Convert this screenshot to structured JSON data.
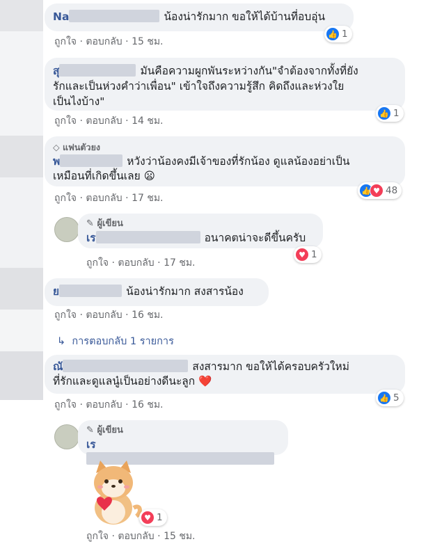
{
  "comments": [
    {
      "name": "Na",
      "text": "น้องน่ารักมาก ขอให้ได้บ้านที่อบอุ่น",
      "like_label": "ถูกใจ",
      "reply_label": "ตอบกลับ",
      "time": "15 ชม.",
      "reaction_count": "1"
    },
    {
      "name": "สุ",
      "text_line1": "มันคือความผูกพันระหว่างกัน\"จำต้องจากทั้งที่ยัง",
      "text_line2": "รักและเป็นห่วงคำว่าเพื่อน\" เข้าใจถึงความรู้สึก คิดถึงและห่วงใย",
      "text_line3": "เป็นไงบ้าง\"",
      "like_label": "ถูกใจ",
      "reply_label": "ตอบกลับ",
      "time": "14 ชม.",
      "reaction_count": "1"
    },
    {
      "badge": "แฟนตัวยง",
      "name": "พ",
      "text_line1": "หวังว่าน้องคงมีเจ้าของที่รักน้อง ดูแลน้องอย่าเป็น",
      "text_line2": "เหมือนที่เกิดขึ้นเลย",
      "emoji": "😦",
      "like_label": "ถูกใจ",
      "reply_label": "ตอบกลับ",
      "time": "17 ชม.",
      "reaction_count": "48"
    },
    {
      "author_tag": "ผู้เขียน",
      "name": "เร",
      "text": "อนาคตน่าจะดีขึ้นครับ",
      "like_label": "ถูกใจ",
      "reply_label": "ตอบกลับ",
      "time": "17 ชม.",
      "reaction_count": "1"
    },
    {
      "name": "ย",
      "text": "น้องน่ารักมาก สงสารน้อง",
      "like_label": "ถูกใจ",
      "reply_label": "ตอบกลับ",
      "time": "16 ชม."
    },
    {
      "name": "ณั",
      "text_line1": "สงสารมาก ขอให้ได้ครอบครัวใหม่",
      "text_line2": "ที่รักและดูแลนู๋เป็นอย่างดีนะลูก",
      "emoji": "❤️",
      "like_label": "ถูกใจ",
      "reply_label": "ตอบกลับ",
      "time": "16 ชม.",
      "reaction_count": "5"
    },
    {
      "author_tag": "ผู้เขียน",
      "name": "เร",
      "sticker": "shiba-heart-sticker",
      "like_label": "ถูกใจ",
      "reply_label": "ตอบกลับ",
      "time": "15 ชม.",
      "reaction_count": "1"
    }
  ],
  "replies_link": "การตอบกลับ 1 รายการ",
  "separator": "·",
  "colors": {
    "link": "#385898",
    "like": "#1877f2",
    "love": "#f33e58",
    "bubble": "#f0f2f5",
    "muted": "#65676b"
  }
}
